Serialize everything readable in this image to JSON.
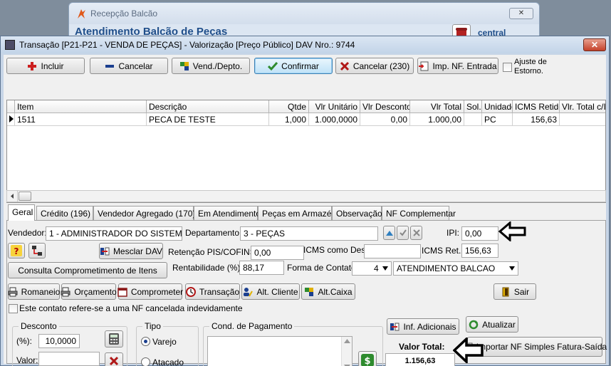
{
  "background_window": {
    "title": "Recepção Balcão",
    "heading": "Atendimento Balcão de Peças",
    "right_label": "central",
    "close_glyph": "✕"
  },
  "window": {
    "title": "Transação [P21-P21 - VENDA DE PEÇAS] - Valorização [Preço Público]  DAV Nro.: 9744",
    "close_glyph": "✕"
  },
  "toolbar": {
    "incluir": "Incluir",
    "cancelar": "Cancelar",
    "vend_depto": "Vend./Depto.",
    "confirmar": "Confirmar",
    "cancelar_count": "Cancelar (230)",
    "imp_nf_entrada": "Imp. NF. Entrada",
    "ajuste_line1": "Ajuste  de",
    "ajuste_line2": "Estorno."
  },
  "grid": {
    "columns": [
      "Item",
      "Descrição",
      "Qtde",
      "Vlr Unitário",
      "Vlr Desconto",
      "Vlr Total",
      "Sol.",
      "Unidade",
      "ICMS Retido",
      "Vlr. Total c/IC"
    ],
    "rows": [
      [
        "1511",
        "PECA DE TESTE",
        "1,000",
        "1.000,0000",
        "0,00",
        "1.000,00",
        "",
        "PC",
        "156,63",
        ""
      ]
    ]
  },
  "tabs": [
    "Geral",
    "Crédito (196)",
    "Vendedor Agregado (170)",
    "Em Atendimento",
    "Peças em Armazém",
    "Observação",
    "NF Complementar"
  ],
  "form": {
    "vendedor_label": "Vendedor:",
    "vendedor_value": "1 - ADMINISTRADOR DO SISTEMA",
    "departamento_label": "Departamento:",
    "departamento_value": "3 - PEÇAS",
    "ipi_label": "IPI:",
    "ipi_value": "0,00",
    "mesclar_dav": "Mesclar DAV",
    "retencao_label": "Retenção PIS/COFINS:",
    "retencao_value": "0,00",
    "icms_desc_label": "ICMS como Desc:",
    "icms_desc_value": "",
    "icms_ret_label": "ICMS Ret.:",
    "icms_ret_value": "156,63",
    "consulta_btn": "Consulta Comprometimento de Itens",
    "rentabilidade_label": "Rentabilidade (%):",
    "rentabilidade_value": "88,17",
    "forma_contato_label": "Forma de Contato:",
    "forma_contato_code": "4",
    "forma_contato_value": "ATENDIMENTO BALCAO"
  },
  "actions": {
    "romaneio": "Romaneio",
    "orcamento": "Orçamento",
    "comprometer": "Comprometer",
    "transacao": "Transação",
    "alt_cliente": "Alt. Cliente",
    "alt_caixa": "Alt.Caixa",
    "sair": "Sair"
  },
  "nf_cancelada_label": "Este contato refere-se a uma NF cancelada indevidamente",
  "desconto": {
    "title": "Desconto",
    "percent_label": "(%):",
    "percent_value": "10,0000",
    "valor_label": "Valor:",
    "valor_value": ""
  },
  "tipo": {
    "title": "Tipo",
    "varejo": "Varejo",
    "atacado": "Atacado",
    "selected": "Varejo"
  },
  "cond_pagamento": {
    "title": "Cond. de Pagamento"
  },
  "right_panel": {
    "inf_adicionais": "Inf. Adicionais",
    "atualizar": "Atualizar",
    "valor_total_label": "Valor Total:",
    "valor_total_value": "1.156,63",
    "importar_nf": "Importar NF Simples Fatura-Saída"
  },
  "colors": {
    "title_blue": "#1f4e8a",
    "cancel_red": "#cc1f1f",
    "confirm_green": "#2e8b2e"
  }
}
